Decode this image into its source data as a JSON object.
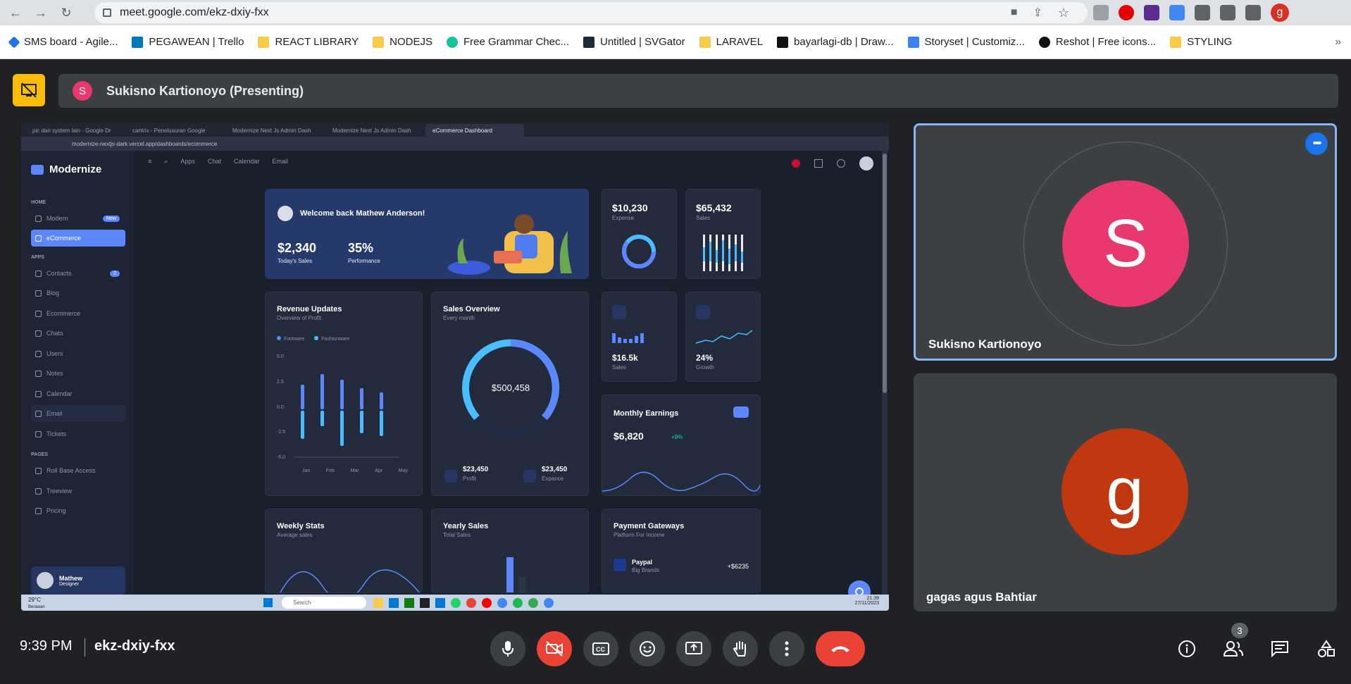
{
  "browser": {
    "url": "meet.google.com/ekz-dxiy-fxx",
    "profile_initial": "g",
    "bookmarks": [
      {
        "label": "SMS board - Agile...",
        "icon": "diamond-icon",
        "color": "#1a73e8"
      },
      {
        "label": "PEGAWEAN | Trello",
        "icon": "trello-icon",
        "color": "#0079bf"
      },
      {
        "label": "REACT LIBRARY",
        "icon": "folder-icon",
        "color": "#f9cc47"
      },
      {
        "label": "NODEJS",
        "icon": "folder-icon",
        "color": "#f9cc47"
      },
      {
        "label": "Free Grammar Chec...",
        "icon": "grammar-icon",
        "color": "#15c39a"
      },
      {
        "label": "Untitled | SVGator",
        "icon": "svgator-icon",
        "color": "#1f2937"
      },
      {
        "label": "LARAVEL",
        "icon": "folder-icon",
        "color": "#f9cc47"
      },
      {
        "label": "bayarlagi-db | Draw...",
        "icon": "drawsql-icon",
        "color": "#111111"
      },
      {
        "label": "Storyset | Customiz...",
        "icon": "storyset-icon",
        "color": "#3b82f6"
      },
      {
        "label": "Reshot | Free icons...",
        "icon": "reshot-icon",
        "color": "#111111"
      },
      {
        "label": "STYLING",
        "icon": "folder-icon",
        "color": "#f9cc47"
      }
    ],
    "more_bookmarks": "»"
  },
  "meet": {
    "presenter_initial": "S",
    "presenter_label": "Sukisno Kartionoyo (Presenting)",
    "time": "9:39 PM",
    "meeting_code": "ekz-dxiy-fxx",
    "participants_count": "3",
    "tiles": [
      {
        "name": "Sukisno Kartionoyo",
        "initial": "S",
        "color": "#e8386d"
      },
      {
        "name": "gagas agus Bahtiar",
        "initial": "g",
        "color": "#c1370f"
      }
    ]
  },
  "shared_screen": {
    "tabs": [
      "pic dari system lain - Google Dr",
      "cantrix - Penelusuran Google",
      "Modernize Next Js Admin Dash",
      "Modernize Next Js Admin Dash",
      "eCommerce Dashboard"
    ],
    "address": "modernize-nextjs-dark.vercel.app/dashboards/ecommerce",
    "logo": "Modernize",
    "sections": {
      "home": "HOME",
      "apps": "APPS",
      "pages": "PAGES"
    },
    "home_items": [
      {
        "label": "Modern",
        "badge": "New"
      },
      {
        "label": "eCommerce",
        "badge": ""
      }
    ],
    "app_items": [
      {
        "label": "Contacts",
        "badge": "2"
      },
      {
        "label": "Blog",
        "badge": ""
      },
      {
        "label": "Ecommerce",
        "badge": ""
      },
      {
        "label": "Chats",
        "badge": ""
      },
      {
        "label": "Users",
        "badge": ""
      },
      {
        "label": "Notes",
        "badge": ""
      },
      {
        "label": "Calendar",
        "badge": ""
      },
      {
        "label": "Email",
        "badge": ""
      },
      {
        "label": "Tickets",
        "badge": ""
      }
    ],
    "page_items": [
      "Roll Base Access",
      "Treeview",
      "Pricing"
    ],
    "user": {
      "name": "Mathew",
      "role": "Designer"
    },
    "topnav": [
      "Apps",
      "Chat",
      "Calendar",
      "Email"
    ],
    "welcome": {
      "title": "Welcome back Mathew Anderson!",
      "sales": "$2,340",
      "sales_label": "Today's Sales",
      "perf": "35%",
      "perf_label": "Performance"
    },
    "expense": {
      "value": "$10,230",
      "label": "Expense"
    },
    "sales": {
      "value": "$65,432",
      "label": "Sales"
    },
    "revenue": {
      "title": "Revenue Updates",
      "sub": "Overview of Profit",
      "legend": [
        "Footware",
        "Fashionware"
      ],
      "yticks": [
        "5.0",
        "2.5",
        "0.0",
        "-2.5",
        "-5.0"
      ],
      "xticks": [
        "Jan",
        "Feb",
        "Mar",
        "Apr",
        "May"
      ]
    },
    "overview": {
      "title": "Sales Overview",
      "sub": "Every month",
      "total": "$500,458",
      "profit": "$23,450",
      "profit_label": "Profit",
      "expense": "$23,450",
      "expense_label": "Expance"
    },
    "mini1": {
      "value": "$16.5k",
      "label": "Sales"
    },
    "mini2": {
      "value": "24%",
      "label": "Growth"
    },
    "earnings": {
      "title": "Monthly Earnings",
      "value": "$6,820",
      "delta": "+9%"
    },
    "weekly": {
      "title": "Weekly Stats",
      "sub": "Average sales"
    },
    "yearly": {
      "title": "Yearly Sales",
      "sub": "Total Sales"
    },
    "gateways": {
      "title": "Payment Gateways",
      "sub": "Platform For Income",
      "name": "Paypal",
      "desc": "Big Brands",
      "amount": "+$6235"
    },
    "taskbar": {
      "weather": "29°C",
      "weather_sub": "Berawan",
      "search": "Search",
      "clock": "21:39",
      "date": "27/11/2023"
    }
  }
}
